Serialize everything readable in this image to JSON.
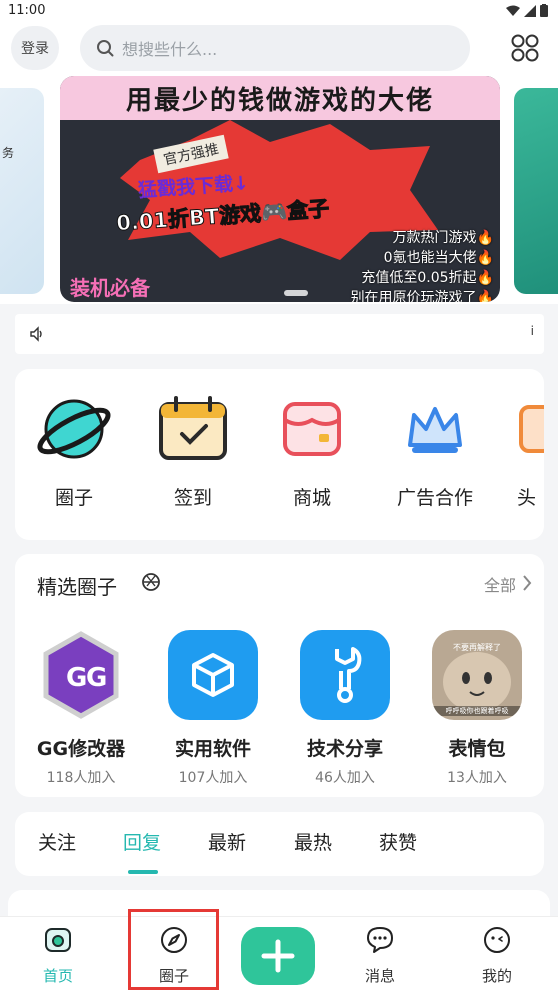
{
  "status": {
    "time": "11:00"
  },
  "topbar": {
    "login_label": "登录",
    "search_placeholder": "想搜些什么...",
    "grid_icon": "grid-icon"
  },
  "banner": {
    "left_peek_text": "务",
    "title": "用最少的钱做游戏的大佬",
    "sticker": "官方强推",
    "line1": "猛戳我下载↓",
    "line2": "0.01折BT游戏🎮盒子",
    "tag": "装机必备",
    "right_lines": [
      "万款热门游戏🔥",
      "0氪也能当大佬🔥",
      "充值低至0.05折起🔥",
      "别在用原价玩游戏了🔥"
    ]
  },
  "notice": {
    "icon": "speaker-icon",
    "right_mark": "i"
  },
  "quick": {
    "items": [
      {
        "label": "圈子",
        "icon": "planet-icon"
      },
      {
        "label": "签到",
        "icon": "calendar-check-icon"
      },
      {
        "label": "商城",
        "icon": "store-icon"
      },
      {
        "label": "广告合作",
        "icon": "crown-icon"
      },
      {
        "label": "头",
        "icon": "partial-icon"
      }
    ]
  },
  "circles": {
    "title": "精选圈子",
    "more": "全部",
    "items": [
      {
        "name": "GG修改器",
        "count": "118人加入",
        "icon": "gg-icon"
      },
      {
        "name": "实用软件",
        "count": "107人加入",
        "icon": "box-icon"
      },
      {
        "name": "技术分享",
        "count": "46人加入",
        "icon": "wrench-icon"
      },
      {
        "name": "表情包",
        "count": "13人加入",
        "icon": "cat-meme-icon",
        "meme_top": "不要再解释了",
        "meme_bottom": "呼呼吸你也跟着呼吸"
      }
    ]
  },
  "tabs": {
    "items": [
      "关注",
      "回复",
      "最新",
      "最热",
      "获赞"
    ],
    "active_index": 1
  },
  "nav": {
    "items": [
      {
        "label": "首页",
        "icon": "home-icon"
      },
      {
        "label": "圈子",
        "icon": "compass-icon"
      },
      {
        "label": "消息",
        "icon": "message-icon"
      },
      {
        "label": "我的",
        "icon": "profile-icon"
      }
    ],
    "add_icon": "plus-icon"
  },
  "colors": {
    "accent": "#25b8b0",
    "add_button": "#2fc59a",
    "highlight": "#e53935"
  }
}
